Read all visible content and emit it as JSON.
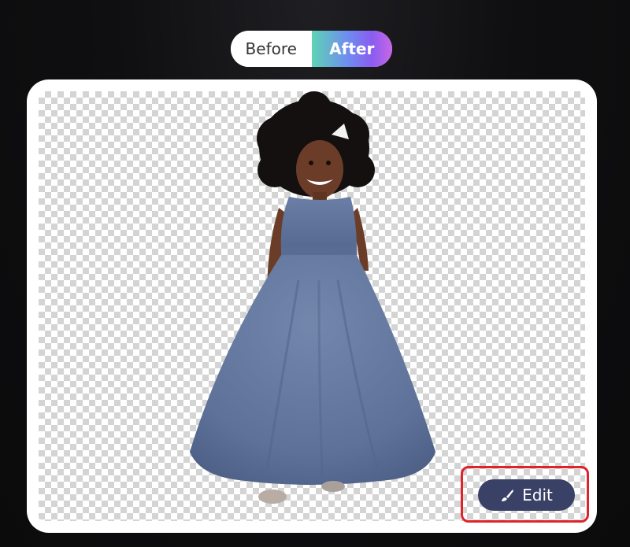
{
  "toggle": {
    "before_label": "Before",
    "after_label": "After",
    "active": "After"
  },
  "canvas": {
    "background": "transparent-checkerboard",
    "subject": "child-in-blue-tulle-dress"
  },
  "edit": {
    "label": "Edit",
    "icon": "brush-icon",
    "highlighted": true
  },
  "colors": {
    "page_background": "#0e0e10",
    "after_gradient_start": "#5fd3b4",
    "after_gradient_end": "#c966e6",
    "edit_button_bg": "#3a4166",
    "highlight_border": "#e0232b"
  }
}
